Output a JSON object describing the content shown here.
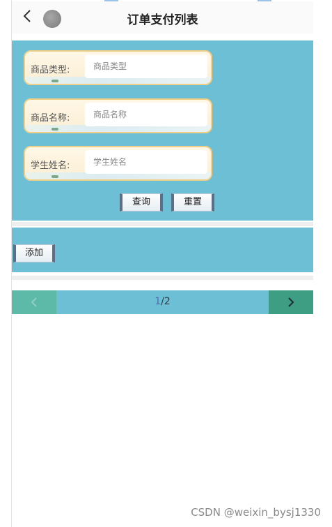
{
  "header": {
    "title": "订单支付列表"
  },
  "search": {
    "fields": [
      {
        "label": "商品类型:",
        "placeholder": "商品类型",
        "value": ""
      },
      {
        "label": "商品名称:",
        "placeholder": "商品名称",
        "value": ""
      },
      {
        "label": "学生姓名:",
        "placeholder": "学生姓名",
        "value": ""
      }
    ],
    "query_label": "查询",
    "reset_label": "重置"
  },
  "actions": {
    "add_label": "添加"
  },
  "pagination": {
    "current": "1",
    "separator": "/",
    "total": "2",
    "prev_icon": "chevron-left-icon",
    "next_icon": "chevron-right-icon"
  },
  "watermark": "CSDN @weixin_bysj1330",
  "colors": {
    "panel": "#6cbfd4",
    "prev_button": "#5db9a8",
    "next_button": "#3d9e84"
  }
}
